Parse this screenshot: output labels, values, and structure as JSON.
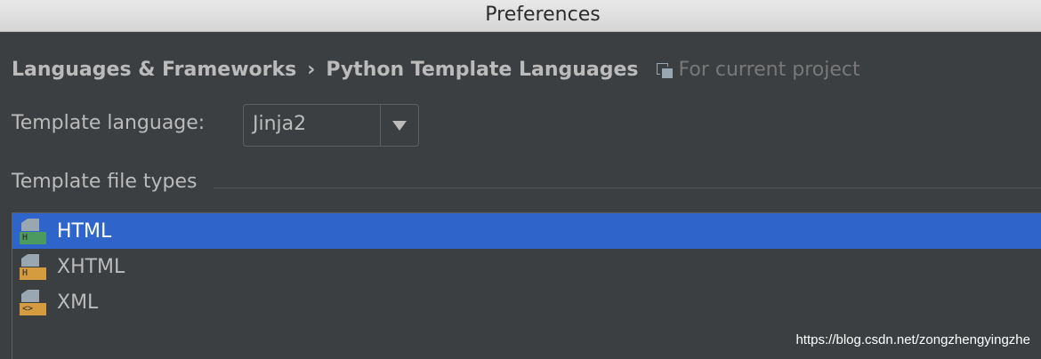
{
  "window": {
    "title": "Preferences"
  },
  "breadcrumb": {
    "items": [
      "Languages & Frameworks",
      "Python Template Languages"
    ],
    "separator": "›",
    "scope_icon": "project-scope-icon",
    "scope_label": "For current project"
  },
  "template_language": {
    "label": "Template language:",
    "value": "Jinja2",
    "dropdown_icon": "triangle-down-icon"
  },
  "file_types": {
    "section_title": "Template file types",
    "items": [
      {
        "label": "HTML",
        "badge": "H",
        "badge_color": "#4c9a5f",
        "icon": "html-file-icon",
        "selected": true
      },
      {
        "label": "XHTML",
        "badge": "H",
        "badge_color": "#d59b3f",
        "icon": "xhtml-file-icon",
        "selected": false
      },
      {
        "label": "XML",
        "badge": "<>",
        "badge_color": "#d59b3f",
        "icon": "xml-file-icon",
        "selected": false
      }
    ]
  },
  "watermark": "https://blog.csdn.net/zongzhengyingzhe",
  "colors": {
    "background": "#3c3f41",
    "selection": "#2f65ca",
    "text": "#bbbbbb",
    "muted_text": "#787878"
  }
}
